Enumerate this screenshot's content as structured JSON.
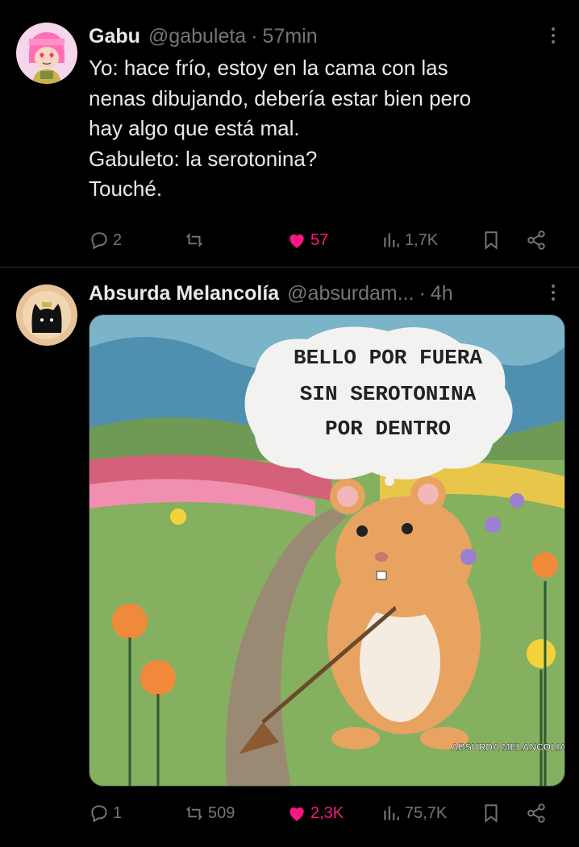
{
  "tweets": [
    {
      "name": "Gabu",
      "handle": "@gabuleta",
      "separator": "·",
      "time": "57min",
      "text_lines": [
        "Yo: hace frío, estoy en la cama con las",
        "nenas dibujando, debería estar bien pero",
        "hay algo que está mal.",
        "Gabuleto: la serotonina?",
        "Touché."
      ],
      "replies": "2",
      "reposts": "",
      "likes": "57",
      "views": "1,7K",
      "liked": true
    },
    {
      "name": "Absurda Melancolía",
      "handle": "@absurdam...",
      "separator": "·",
      "time": "4h",
      "image": {
        "caption_lines": [
          "BELLO POR FUERA",
          "SIN SEROTONINA",
          "POR DENTRO"
        ],
        "signature": "ABSURDA MELANCOLIA"
      },
      "replies": "1",
      "reposts": "509",
      "likes": "2,3K",
      "views": "75,7K",
      "liked": true
    }
  ],
  "colors": {
    "background": "#000000",
    "text": "#e7e9ea",
    "muted": "#71767b",
    "like": "#f91880",
    "divider": "#2f3336"
  },
  "icons": [
    "reply-icon",
    "repost-icon",
    "heart-icon",
    "views-icon",
    "bookmark-icon",
    "share-icon",
    "more-icon"
  ]
}
